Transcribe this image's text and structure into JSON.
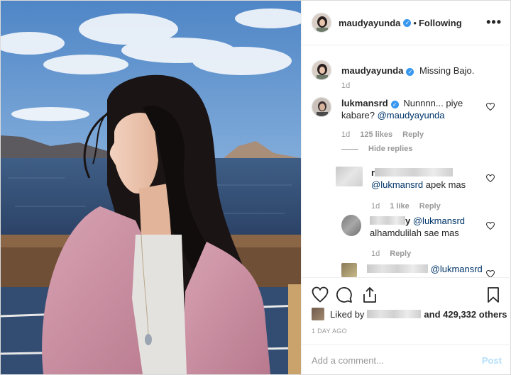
{
  "header": {
    "username": "maudyayunda",
    "separator": "•",
    "follow_status": "Following",
    "more_glyph": "•••"
  },
  "caption": {
    "username": "maudyayunda",
    "text": "Missing Bajo.",
    "time": "1d"
  },
  "comments": [
    {
      "username": "lukmansrd",
      "text_line1": "Nunnnn... piye",
      "text_line2": "kabare? ",
      "mention": "@maudyayunda",
      "time": "1d",
      "likes": "125 likes",
      "reply": "Reply",
      "hide_replies": "Hide replies"
    }
  ],
  "replies": [
    {
      "username_visible": "r",
      "mention": "@lukmansrd",
      "text": " apek mas",
      "time": "1d",
      "likes": "1 like",
      "reply": "Reply"
    },
    {
      "username_visible": "y",
      "mention": "@lukmansrd",
      "text": "alhamdulilah sae mas",
      "time": "1d",
      "reply": "Reply"
    },
    {
      "mention": "@lukmansrd"
    }
  ],
  "likes": {
    "prefix": "Liked by",
    "suffix": "and 429,332 others"
  },
  "time_ago": "1 DAY AGO",
  "add_comment": {
    "placeholder": "Add a comment...",
    "post_label": "Post"
  },
  "icons": {
    "verified": "verified-badge-icon",
    "like": "heart-icon",
    "comment": "comment-bubble-icon",
    "share": "share-icon",
    "save": "bookmark-icon"
  },
  "colors": {
    "verified": "#3897f0",
    "mention": "#003569",
    "muted": "#999999",
    "post_disabled": "#b2dffc"
  }
}
